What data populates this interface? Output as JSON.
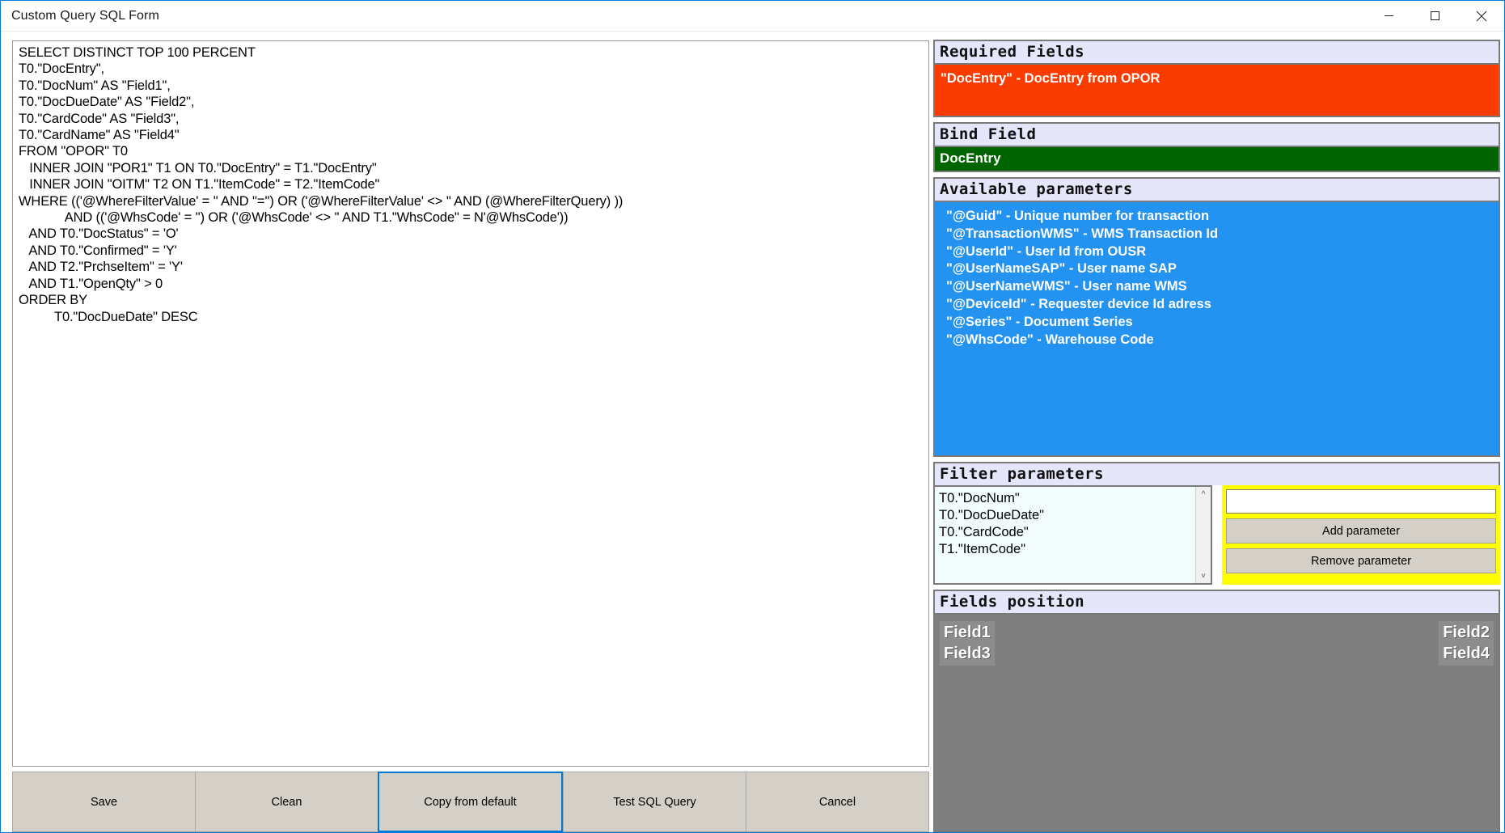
{
  "window": {
    "title": "Custom Query SQL Form",
    "minimize_icon": "minimize-icon",
    "maximize_icon": "maximize-icon",
    "close_icon": "close-icon"
  },
  "sql_editor": {
    "value": "SELECT DISTINCT TOP 100 PERCENT\nT0.\"DocEntry\",\nT0.\"DocNum\" AS \"Field1\",\nT0.\"DocDueDate\" AS \"Field2\",\nT0.\"CardCode\" AS \"Field3\",\nT0.\"CardName\" AS \"Field4\"\nFROM \"OPOR\" T0\n   INNER JOIN \"POR1\" T1 ON T0.\"DocEntry\" = T1.\"DocEntry\"\n   INNER JOIN \"OITM\" T2 ON T1.\"ItemCode\" = T2.\"ItemCode\"\nWHERE (('@WhereFilterValue' = '' AND ''='') OR ('@WhereFilterValue' <> '' AND (@WhereFilterQuery) ))\n             AND (('@WhsCode' = '') OR ('@WhsCode' <> '' AND T1.\"WhsCode\" = N'@WhsCode'))\n   AND T0.\"DocStatus\" = 'O'\n   AND T0.\"Confirmed\" = 'Y'\n   AND T2.\"PrchseItem\" = 'Y'\n   AND T1.\"OpenQty\" > 0\nORDER BY\n          T0.\"DocDueDate\" DESC"
  },
  "form_buttons": [
    {
      "label": "Save",
      "name": "save-button",
      "focused": false
    },
    {
      "label": "Clean",
      "name": "clean-button",
      "focused": false
    },
    {
      "label": "Copy from default",
      "name": "copy-from-default-button",
      "focused": true
    },
    {
      "label": "Test SQL Query",
      "name": "test-sql-query-button",
      "focused": false
    },
    {
      "label": "Cancel",
      "name": "cancel-button",
      "focused": false
    }
  ],
  "required_fields": {
    "header": "Required Fields",
    "items": [
      "\"DocEntry\" - DocEntry from OPOR"
    ]
  },
  "bind_field": {
    "header": "Bind Field",
    "value": "DocEntry"
  },
  "available_parameters": {
    "header": "Available parameters",
    "items": [
      "\"@Guid\" - Unique number for transaction",
      "\"@TransactionWMS\" - WMS Transaction Id",
      "\"@UserId\" - User Id from OUSR",
      "\"@UserNameSAP\" - User name SAP",
      "\"@UserNameWMS\" - User name WMS",
      "\"@DeviceId\" - Requester device Id adress",
      "\"@Series\" - Document Series",
      "\"@WhsCode\" - Warehouse Code"
    ]
  },
  "filter_parameters": {
    "header": "Filter parameters",
    "items": [
      "T0.\"DocNum\"",
      "T0.\"DocDueDate\"",
      "T0.\"CardCode\"",
      "T1.\"ItemCode\""
    ],
    "input_value": "",
    "input_placeholder": "",
    "add_label": "Add parameter",
    "remove_label": "Remove parameter",
    "scroll_up_icon": "chevron-up-icon",
    "scroll_down_icon": "chevron-down-icon"
  },
  "fields_position": {
    "header": "Fields position",
    "left": [
      "Field1",
      "Field3"
    ],
    "right": [
      "Field2",
      "Field4"
    ]
  },
  "colors": {
    "accent": "#0078d7",
    "required_bg": "#fa3c00",
    "bind_bg": "#006400",
    "params_bg": "#2392f0",
    "highlight_yellow": "#ffff00",
    "header_bg": "#e6e6fa",
    "fields_position_bg": "#7f7f7f"
  }
}
